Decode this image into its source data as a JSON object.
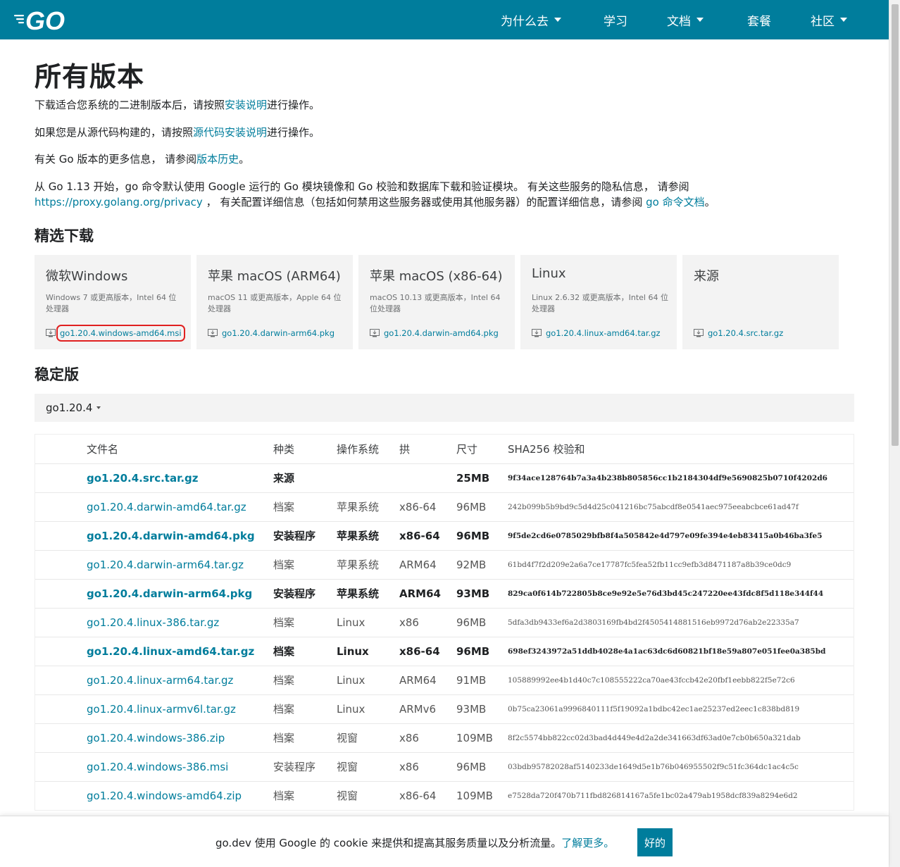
{
  "header": {
    "logo": "GO",
    "nav": [
      {
        "label": "为什么去",
        "dropdown": true
      },
      {
        "label": "学习",
        "dropdown": false
      },
      {
        "label": "文档",
        "dropdown": true
      },
      {
        "label": "套餐",
        "dropdown": false
      },
      {
        "label": "社区",
        "dropdown": true
      }
    ]
  },
  "page": {
    "title": "所有版本",
    "p1": {
      "before": "下载适合您系统的二进制版本后，请按照",
      "link": "安装说明",
      "after": "进行操作。"
    },
    "p2": {
      "before": "如果您是从源代码构建的，请按照",
      "link": "源代码安装说明",
      "after": "进行操作。"
    },
    "p3": {
      "before": "有关 Go 版本的更多信息， 请参阅",
      "link": "版本历史",
      "after": "。"
    },
    "p4": {
      "line1": "从 Go 1.13 开始，go 命令默认使用 Google 运行的 Go 模块镜像和 Go 校验和数据库下载和验证模块。 有关这些服务的隐私信息， 请参阅",
      "link1": "https://proxy.golang.org/privacy",
      "mid": " ， 有关配置详细信息（包括如何禁用这些服务器或使用其他服务器）的配置详细信息，请参阅 ",
      "link2": "go 命令文档",
      "end": "。"
    },
    "featured_heading": "精选下载",
    "stable_heading": "稳定版"
  },
  "featured": [
    {
      "title": "微软Windows",
      "desc": "Windows 7 或更高版本，Intel 64 位处理器",
      "file": "go1.20.4.windows-amd64.msi",
      "highlighted": true
    },
    {
      "title": "苹果 macOS (ARM64)",
      "desc": "macOS 11 或更高版本，Apple 64 位处理器",
      "file": "go1.20.4.darwin-arm64.pkg",
      "highlighted": false
    },
    {
      "title": "苹果 macOS (x86-64)",
      "desc": "macOS 10.13 或更高版本，Intel 64 位处理器",
      "file": "go1.20.4.darwin-amd64.pkg",
      "highlighted": false
    },
    {
      "title": "Linux",
      "desc": "Linux 2.6.32 或更高版本，Intel 64 位处理器",
      "file": "go1.20.4.linux-amd64.tar.gz",
      "highlighted": false
    },
    {
      "title": "来源",
      "desc": "",
      "file": "go1.20.4.src.tar.gz",
      "highlighted": false
    }
  ],
  "version_selector": "go1.20.4",
  "table": {
    "headers": [
      "文件名",
      "种类",
      "操作系统",
      "拱",
      "尺寸",
      "SHA256 校验和"
    ],
    "rows": [
      {
        "file": "go1.20.4.src.tar.gz",
        "kind": "来源",
        "os": "",
        "arch": "",
        "size": "25MB",
        "sha": "9f34ace128764b7a3a4b238b805856cc1b2184304df9e5690825b0710f4202d6",
        "highlight": true
      },
      {
        "file": "go1.20.4.darwin-amd64.tar.gz",
        "kind": "档案",
        "os": "苹果系统",
        "arch": "x86-64",
        "size": "96MB",
        "sha": "242b099b5b9bd9c5d4d25c041216bc75abcdf8e0541aec975eeabcbce61ad47f",
        "highlight": false
      },
      {
        "file": "go1.20.4.darwin-amd64.pkg",
        "kind": "安装程序",
        "os": "苹果系统",
        "arch": "x86-64",
        "size": "96MB",
        "sha": "9f5de2cd6e0785029bfb8f4a505842e4d797e09fe394e4eb83415a0b46ba3fe5",
        "highlight": true
      },
      {
        "file": "go1.20.4.darwin-arm64.tar.gz",
        "kind": "档案",
        "os": "苹果系统",
        "arch": "ARM64",
        "size": "92MB",
        "sha": "61bd4f7f2d209e2a6a7ce17787fc5fea52fb11cc9efb3d8471187a8b39ce0dc9",
        "highlight": false
      },
      {
        "file": "go1.20.4.darwin-arm64.pkg",
        "kind": "安装程序",
        "os": "苹果系统",
        "arch": "ARM64",
        "size": "93MB",
        "sha": "829ca0f614b722805b8ce9e92e5e76d3bd45c247220ee43fdc8f5d118e344f44",
        "highlight": true
      },
      {
        "file": "go1.20.4.linux-386.tar.gz",
        "kind": "档案",
        "os": "Linux",
        "arch": "x86",
        "size": "96MB",
        "sha": "5dfa3db9433ef6a2d3803169fb4bd2f4505414881516eb9972d76ab2e22335a7",
        "highlight": false
      },
      {
        "file": "go1.20.4.linux-amd64.tar.gz",
        "kind": "档案",
        "os": "Linux",
        "arch": "x86-64",
        "size": "96MB",
        "sha": "698ef3243972a51ddb4028e4a1ac63dc6d60821bf18e59a807e051fee0a385bd",
        "highlight": true
      },
      {
        "file": "go1.20.4.linux-arm64.tar.gz",
        "kind": "档案",
        "os": "Linux",
        "arch": "ARM64",
        "size": "91MB",
        "sha": "105889992ee4b1d40c7c108555222ca70ae43fccb42e20fbf1eebb822f5e72c6",
        "highlight": false
      },
      {
        "file": "go1.20.4.linux-armv6l.tar.gz",
        "kind": "档案",
        "os": "Linux",
        "arch": "ARMv6",
        "size": "93MB",
        "sha": "0b75ca23061a9996840111f5f19092a1bdbc42ec1ae25237ed2eec1c838bd819",
        "highlight": false
      },
      {
        "file": "go1.20.4.windows-386.zip",
        "kind": "档案",
        "os": "视窗",
        "arch": "x86",
        "size": "109MB",
        "sha": "8f2c5574bb822cc02d3bad4d449e4d2a2de341663df63ad0e7cb0b650a321dab",
        "highlight": false
      },
      {
        "file": "go1.20.4.windows-386.msi",
        "kind": "安装程序",
        "os": "视窗",
        "arch": "x86",
        "size": "96MB",
        "sha": "03bdb95782028af5140233de1649d5e1b76b046955502f9c51fc364dc1ac4c5c",
        "highlight": false
      },
      {
        "file": "go1.20.4.windows-amd64.zip",
        "kind": "档案",
        "os": "视窗",
        "arch": "x86-64",
        "size": "109MB",
        "sha": "e7528da720f470b711fbd826814167a5fe1bc02a479ab1958dcf839a8294e6d2",
        "highlight": false
      }
    ]
  },
  "cookie": {
    "text": "go.dev 使用 Google 的 cookie 来提供和提高其服务质量以及分析流量。",
    "link": "了解更多。",
    "ok": "好的"
  },
  "colors": {
    "brand": "#007d9c",
    "highlight_box": "#e02020"
  }
}
